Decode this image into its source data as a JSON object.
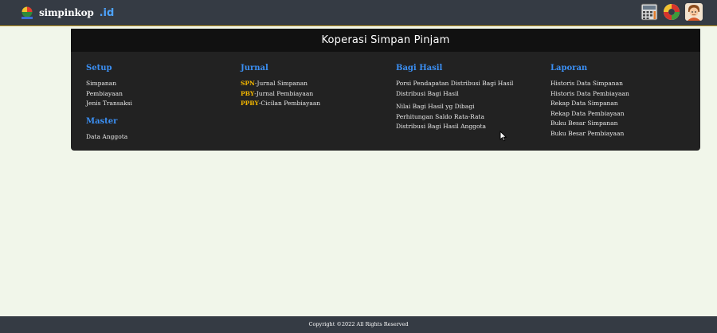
{
  "brand": {
    "name": "simpinkop",
    "tld": ".id"
  },
  "header_icons": [
    {
      "name": "calculator-icon"
    },
    {
      "name": "lifebuoy-icon"
    },
    {
      "name": "user-avatar-icon"
    }
  ],
  "menu": {
    "title": "Koperasi Simpan Pinjam",
    "columns": {
      "setup": {
        "title": "Setup",
        "items": [
          "Simpanan",
          "Pembiayaan",
          "Jenis Transaksi"
        ]
      },
      "master": {
        "title": "Master",
        "items": [
          "Data Anggota"
        ]
      },
      "jurnal": {
        "title": "Jurnal",
        "items": [
          {
            "code": "SPN",
            "label": "-Jurnal Simpanan"
          },
          {
            "code": "PBY",
            "label": "-Jurnal Pembiayaan"
          },
          {
            "code": "PPBY",
            "label": "-Cicilan Pembiayaan"
          }
        ]
      },
      "bagi_hasil": {
        "title": "Bagi Hasil",
        "items": [
          "Porsi Pendapatan Distribusi Bagi Hasil",
          "Distribusi Bagi Hasil",
          "Nilai Bagi Hasil yg Dibagi",
          "Perhitungan Saldo Rata-Rata",
          "Distribusi Bagi Hasil Anggota"
        ]
      },
      "laporan": {
        "title": "Laporan",
        "items": [
          "Historis Data Simpanan",
          "Historis Data Pembiayaan",
          "Rekap Data Simpanan",
          "Rekap Data Pembiayaan",
          "Buku Besar Simpanan",
          "Buku Besar Pembiayaan"
        ]
      }
    }
  },
  "footer": {
    "text": "Copyright ©2022 All Rights Reserved"
  },
  "colors": {
    "navbar": "#353b44",
    "accent_border": "#c9a227",
    "menu_bg": "#222222",
    "menu_header_bg": "#111111",
    "column_title": "#3b8ff3",
    "code_highlight": "#f0b400",
    "page_bg": "#f1f6ea"
  }
}
